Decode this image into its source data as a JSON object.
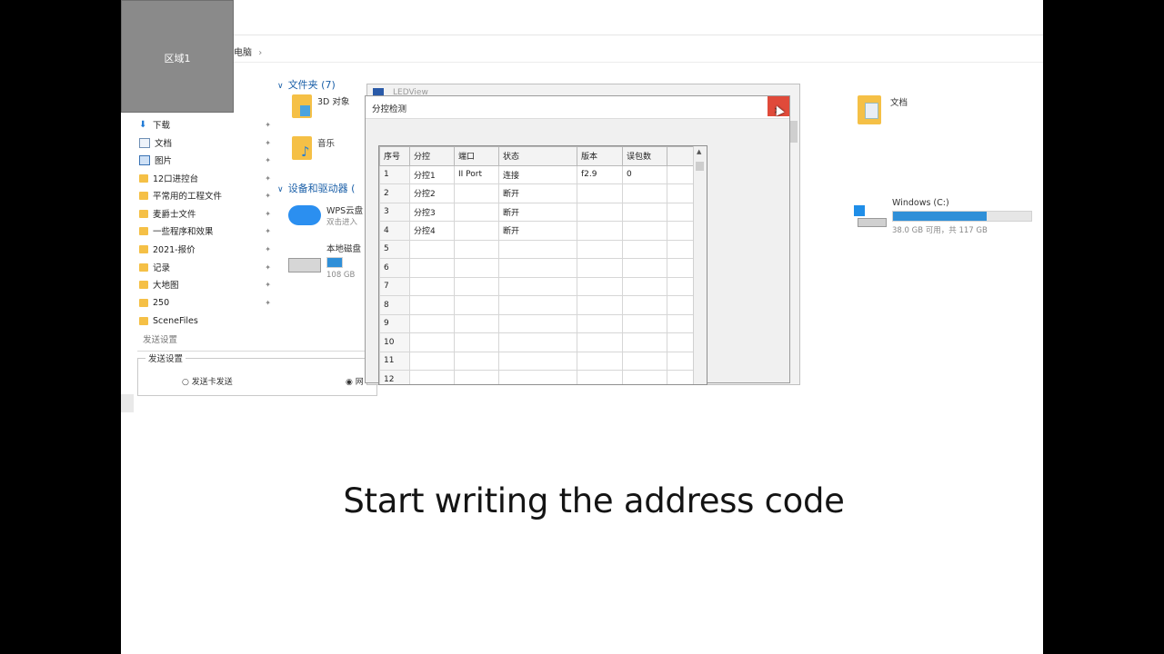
{
  "region_label": "区域1",
  "breadcrumb": "电脑",
  "breadcrumb_sep": "›",
  "nav": [
    {
      "label": "下载",
      "icon": "download-icon"
    },
    {
      "label": "文档",
      "icon": "document-icon"
    },
    {
      "label": "图片",
      "icon": "picture-icon"
    },
    {
      "label": "12口进控台",
      "icon": "folder-icon"
    },
    {
      "label": "平常用的工程文件",
      "icon": "folder-icon"
    },
    {
      "label": "麦爵士文件",
      "icon": "folder-icon"
    },
    {
      "label": "一些程序和效果",
      "icon": "folder-icon"
    },
    {
      "label": "2021-报价",
      "icon": "folder-icon"
    },
    {
      "label": "记录",
      "icon": "folder-icon"
    },
    {
      "label": "大地图",
      "icon": "folder-icon"
    },
    {
      "label": "250",
      "icon": "folder-icon"
    },
    {
      "label": "SceneFiles",
      "icon": "folder-icon"
    }
  ],
  "folders_header": "文件夹 (7)",
  "folders": [
    {
      "label": "3D 对象"
    },
    {
      "label": "音乐"
    },
    {
      "label": "文档"
    }
  ],
  "devices_header": "设备和驱动器 (",
  "wps": {
    "name": "WPS云盘",
    "sub": "双击进入"
  },
  "local_disk": {
    "name": "本地磁盘",
    "sub": "108 GB"
  },
  "windows_drive": {
    "name": "Windows (C:)",
    "usage": "38.0 GB 可用，共 117 GB",
    "used_fraction": 0.68
  },
  "send_settings": {
    "section": "发送设置",
    "group": "发送设置",
    "option1": "发送卡发送",
    "option2": "◉ 网"
  },
  "ledview_title": "LEDView",
  "dialog": {
    "title": "分控检测",
    "close": "✕",
    "columns": [
      "序号",
      "分控",
      "端口",
      "状态",
      "版本",
      "误包数"
    ],
    "rows": [
      [
        "1",
        "分控1",
        "II Port",
        "连接",
        "f2.9",
        "0"
      ],
      [
        "2",
        "分控2",
        "",
        "断开",
        "",
        ""
      ],
      [
        "3",
        "分控3",
        "",
        "断开",
        "",
        ""
      ],
      [
        "4",
        "分控4",
        "",
        "断开",
        "",
        ""
      ],
      [
        "5",
        "",
        "",
        "",
        "",
        ""
      ],
      [
        "6",
        "",
        "",
        "",
        "",
        ""
      ],
      [
        "7",
        "",
        "",
        "",
        "",
        ""
      ],
      [
        "8",
        "",
        "",
        "",
        "",
        ""
      ],
      [
        "9",
        "",
        "",
        "",
        "",
        ""
      ],
      [
        "10",
        "",
        "",
        "",
        "",
        ""
      ],
      [
        "11",
        "",
        "",
        "",
        "",
        ""
      ],
      [
        "12",
        "",
        "",
        "",
        "",
        ""
      ]
    ]
  },
  "subtitle": "Start writing the address code",
  "colors": {
    "accent": "#2f8fd8",
    "close": "#e04a3a",
    "folder": "#f5c046",
    "region": "#8a8a8a"
  }
}
